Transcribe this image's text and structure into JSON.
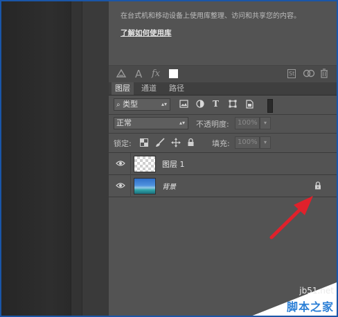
{
  "library": {
    "description": "在台式机和移动设备上使用库整理、访问和共享您的内容。",
    "learn_link": "了解如何使用库"
  },
  "library_toolbar": {
    "icons": [
      "link-icon",
      "text-a-icon",
      "fx-icon",
      "color-swatch-icon",
      "st-icon",
      "cc-sync-icon",
      "trash-icon"
    ],
    "fx_label": "fx",
    "a_label": "A",
    "st_label": "St"
  },
  "tabs": [
    {
      "label": "图层",
      "active": true
    },
    {
      "label": "通道",
      "active": false
    },
    {
      "label": "路径",
      "active": false
    }
  ],
  "filter": {
    "kind_label": "类型",
    "icons": [
      "image-filter-icon",
      "adjustment-filter-icon",
      "type-filter-icon",
      "shape-filter-icon",
      "smart-object-filter-icon"
    ]
  },
  "blend": {
    "mode": "正常",
    "opacity_label": "不透明度:",
    "opacity_value": "100%"
  },
  "lock": {
    "label": "锁定:",
    "fill_label": "填充:",
    "fill_value": "100%"
  },
  "layers": [
    {
      "name": "图层 1",
      "thumbnail": "transparent",
      "visible": true,
      "locked": false
    },
    {
      "name": "背景",
      "thumbnail": "image",
      "visible": true,
      "locked": true
    }
  ],
  "annotation": {
    "arrow_color": "#e0212b"
  },
  "watermark": {
    "site": "jb51.net",
    "name": "脚本之家"
  }
}
